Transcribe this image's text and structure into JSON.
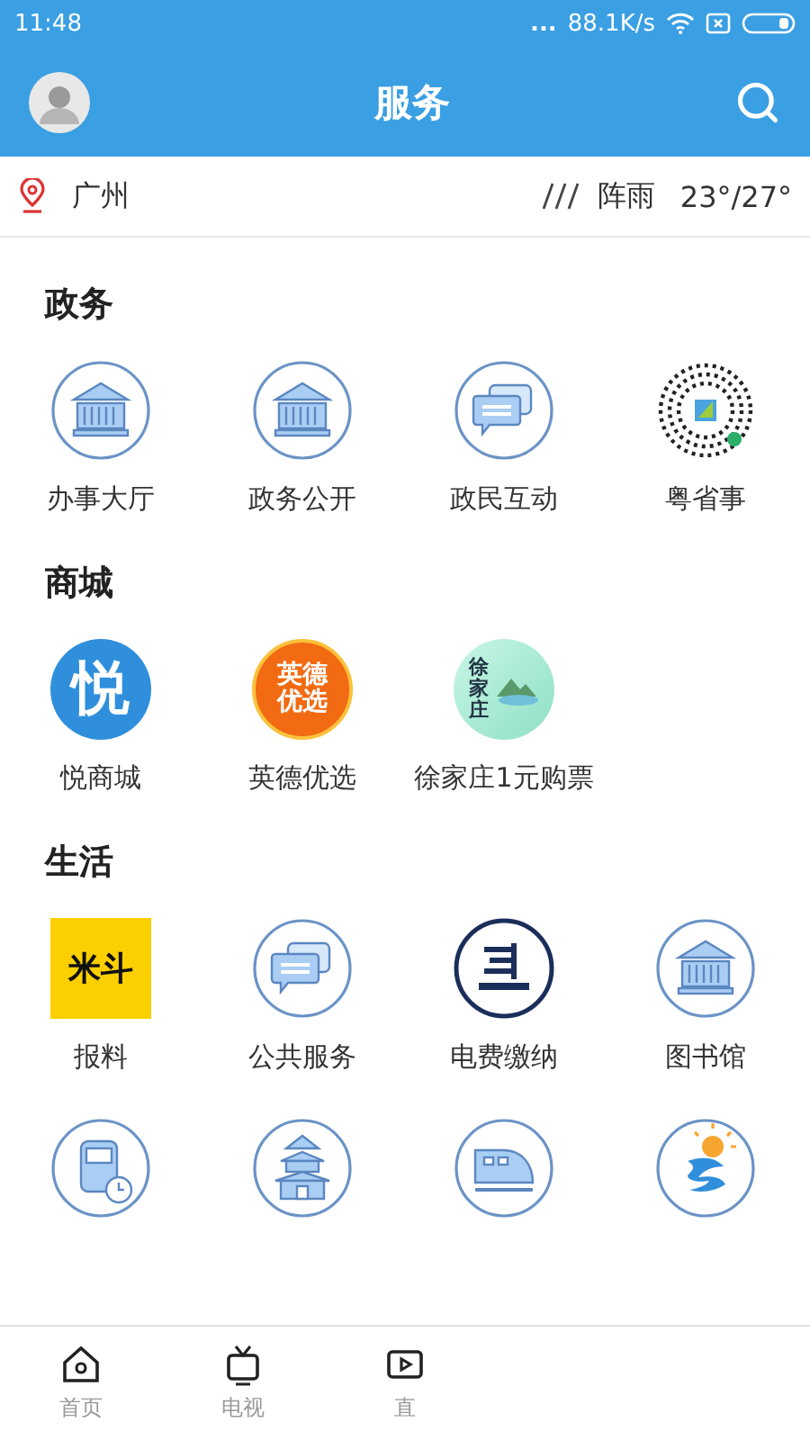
{
  "status_bar": {
    "time": "11:48",
    "dots": "...",
    "speed": "88.1K/s"
  },
  "header": {
    "title": "服务"
  },
  "location": {
    "city": "广州",
    "weather": "阵雨",
    "temperature": "23°/27°"
  },
  "sections": [
    {
      "title": "政务",
      "items": [
        {
          "kind": "bank",
          "label": "办事大厅"
        },
        {
          "kind": "bank",
          "label": "政务公开"
        },
        {
          "kind": "chat",
          "label": "政民互动"
        },
        {
          "kind": "qr",
          "label": "粤省事"
        }
      ]
    },
    {
      "title": "商城",
      "items": [
        {
          "kind": "yue",
          "label": "悦商城",
          "logo_text": [
            "悦"
          ]
        },
        {
          "kind": "orange",
          "label": "英德优选",
          "logo_text": [
            "英德",
            "优选"
          ]
        },
        {
          "kind": "mint",
          "label": "徐家庄1元购票",
          "logo_text": [
            "徐家庄"
          ]
        }
      ]
    },
    {
      "title": "生活",
      "items": [
        {
          "kind": "yellow",
          "label": "报料",
          "logo_text": [
            "米斗"
          ]
        },
        {
          "kind": "chat",
          "label": "公共服务"
        },
        {
          "kind": "grid",
          "label": "电费缴纳"
        },
        {
          "kind": "bank",
          "label": "图书馆"
        }
      ]
    },
    {
      "items": [
        {
          "kind": "bus"
        },
        {
          "kind": "temple"
        },
        {
          "kind": "train"
        },
        {
          "kind": "sun"
        }
      ]
    }
  ],
  "nav": [
    {
      "kind": "home",
      "label": "首页"
    },
    {
      "kind": "tv",
      "label": "电视"
    },
    {
      "kind": "play",
      "label": "直"
    }
  ]
}
